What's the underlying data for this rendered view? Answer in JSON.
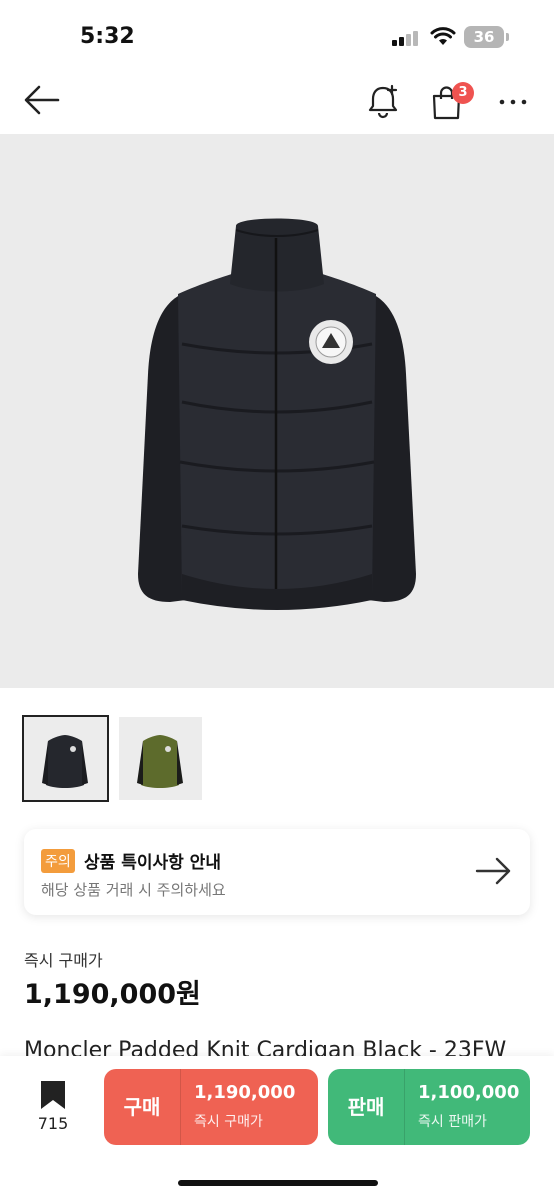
{
  "status": {
    "time": "5:32",
    "battery": "36"
  },
  "nav": {
    "cart_count": "3"
  },
  "product": {
    "images": [
      {
        "alt": "black"
      },
      {
        "alt": "olive"
      }
    ],
    "notice": {
      "tag": "주의",
      "title": "상품 특이사항 안내",
      "subtitle": "해당 상품 거래 시 주의하세요"
    },
    "price_label": "즉시 구매가",
    "price": "1,190,000원",
    "name": "Moncler Padded Knit Cardigan Black - 23FW"
  },
  "bottom": {
    "bookmark_count": "715",
    "buy": {
      "label": "구매",
      "amount": "1,190,000",
      "sub": "즉시 구매가"
    },
    "sell": {
      "label": "판매",
      "amount": "1,100,000",
      "sub": "즉시 판매가"
    }
  },
  "colors": {
    "buy": "#ef6253",
    "sell": "#41b979",
    "badge": "#ef5350",
    "tag": "#f39c3c"
  }
}
